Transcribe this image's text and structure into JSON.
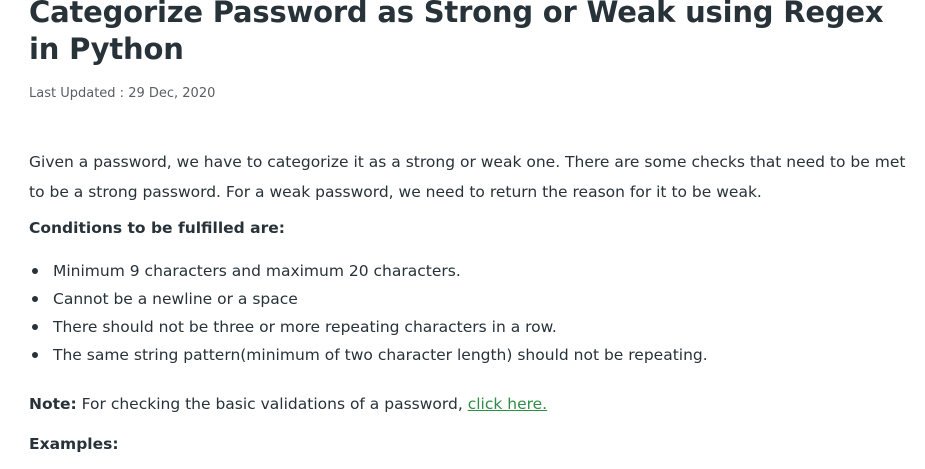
{
  "article": {
    "title": "Categorize Password as Strong or Weak using Regex in Python",
    "last_updated": "Last Updated : 29 Dec, 2020",
    "intro": "Given a password, we have to categorize it as a strong or weak one. There are some checks that need to be met to be a strong password. For a weak password, we need to return the reason for it to be weak.",
    "conditions_heading": "Conditions to be fulfilled are:",
    "conditions": [
      "Minimum 9 characters and maximum 20 characters.",
      "Cannot be a newline or a space",
      "There should not be three or more repeating characters in a row.",
      "The same string pattern(minimum of two character length) should not be repeating."
    ],
    "note_label": "Note:",
    "note_text": " For checking the basic validations of a password, ",
    "note_link": "click here.",
    "examples_heading": "Examples:"
  },
  "colors": {
    "text": "#273239",
    "link": "#2f8d46",
    "meta": "#5a5f63"
  }
}
